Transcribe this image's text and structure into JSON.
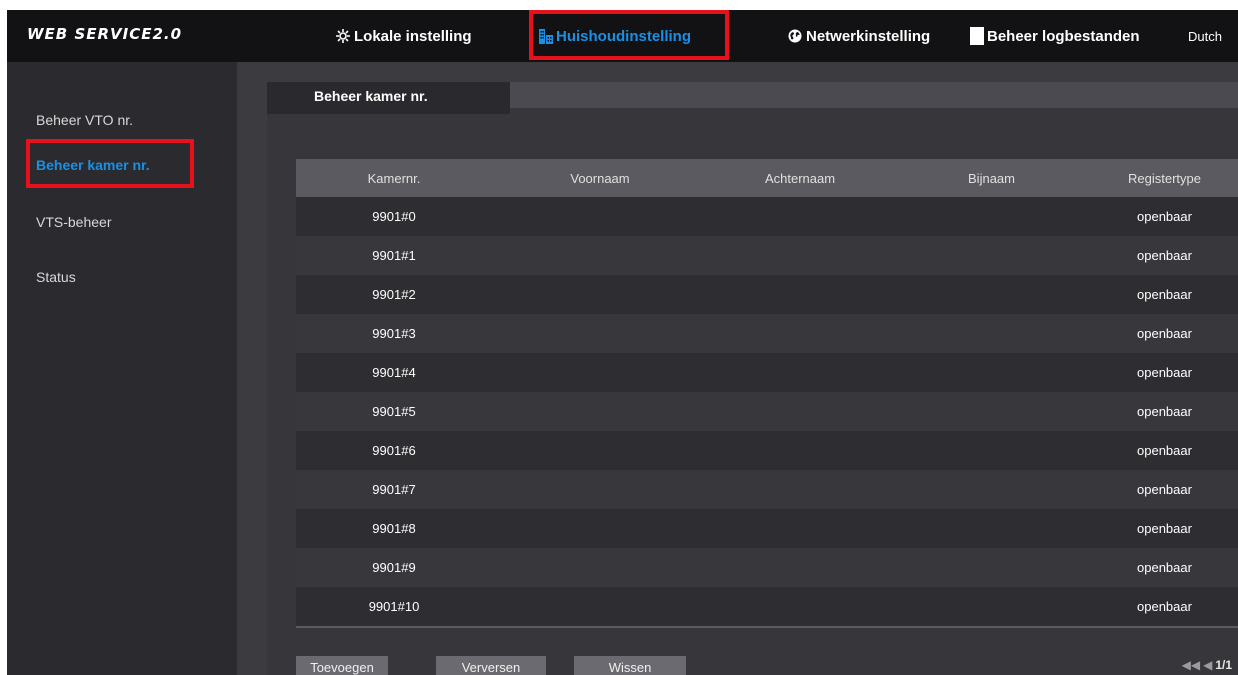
{
  "app": {
    "logo": "WEB SERVICE2.0"
  },
  "nav": {
    "local": "Lokale instelling",
    "household": "Huishoudinstelling",
    "network": "Netwerkinstelling",
    "logs": "Beheer logbestanden",
    "language": "Dutch"
  },
  "sidebar": {
    "items": [
      {
        "label": "Beheer VTO nr."
      },
      {
        "label": "Beheer kamer nr."
      },
      {
        "label": "VTS-beheer"
      },
      {
        "label": "Status"
      }
    ]
  },
  "tab": {
    "label": "Beheer kamer nr."
  },
  "table": {
    "headers": [
      "Kamernr.",
      "Voornaam",
      "Achternaam",
      "Bijnaam",
      "Registertype"
    ],
    "rows": [
      [
        "9901#0",
        "",
        "",
        "",
        "openbaar"
      ],
      [
        "9901#1",
        "",
        "",
        "",
        "openbaar"
      ],
      [
        "9901#2",
        "",
        "",
        "",
        "openbaar"
      ],
      [
        "9901#3",
        "",
        "",
        "",
        "openbaar"
      ],
      [
        "9901#4",
        "",
        "",
        "",
        "openbaar"
      ],
      [
        "9901#5",
        "",
        "",
        "",
        "openbaar"
      ],
      [
        "9901#6",
        "",
        "",
        "",
        "openbaar"
      ],
      [
        "9901#7",
        "",
        "",
        "",
        "openbaar"
      ],
      [
        "9901#8",
        "",
        "",
        "",
        "openbaar"
      ],
      [
        "9901#9",
        "",
        "",
        "",
        "openbaar"
      ],
      [
        "9901#10",
        "",
        "",
        "",
        "openbaar"
      ]
    ]
  },
  "buttons": {
    "add": "Toevoegen",
    "refresh": "Verversen",
    "clear": "Wissen"
  },
  "pager": {
    "page": "1/1"
  },
  "colors": {
    "accent": "#1a8fe3",
    "highlight": "#e8101a"
  }
}
